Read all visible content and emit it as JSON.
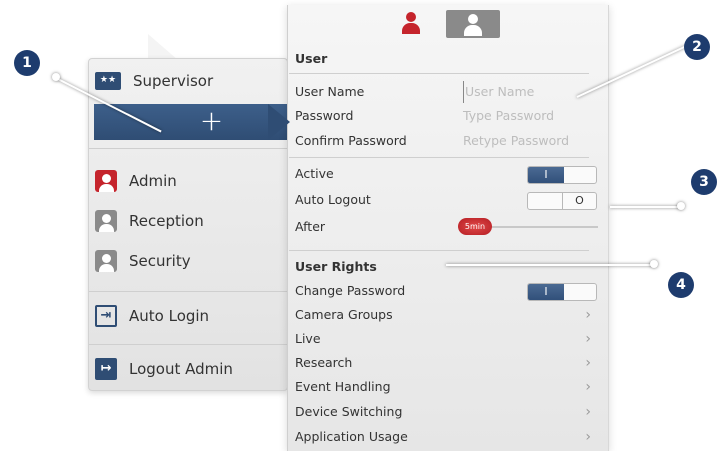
{
  "left_menu": {
    "supervisor_label": "Supervisor",
    "add_label": "+",
    "users": [
      {
        "label": "Admin",
        "icon": "user-red-icon"
      },
      {
        "label": "Reception",
        "icon": "user-gray-icon"
      },
      {
        "label": "Security",
        "icon": "user-gray-icon"
      }
    ],
    "auto_login_label": "Auto Login",
    "logout_label": "Logout Admin"
  },
  "user_panel": {
    "section_user": "User",
    "user_name_label": "User Name",
    "user_name_placeholder": "User Name",
    "password_label": "Password",
    "password_placeholder": "Type Password",
    "confirm_password_label": "Confirm Password",
    "confirm_password_placeholder": "Retype Password",
    "active_label": "Active",
    "active_toggle_on": "I",
    "auto_logout_label": "Auto Logout",
    "auto_logout_toggle_off": "O",
    "after_label": "After",
    "after_value": "5min",
    "section_rights": "User Rights",
    "change_password_label": "Change Password",
    "change_password_toggle_on": "I",
    "rights": [
      "Camera Groups",
      "Live",
      "Research",
      "Event Handling",
      "Device Switching",
      "Application Usage"
    ]
  },
  "callouts": [
    "1",
    "2",
    "3",
    "4"
  ],
  "colors": {
    "accent": "#2f4d74",
    "brand_red": "#c5242c",
    "badge": "#1e3c6e"
  }
}
